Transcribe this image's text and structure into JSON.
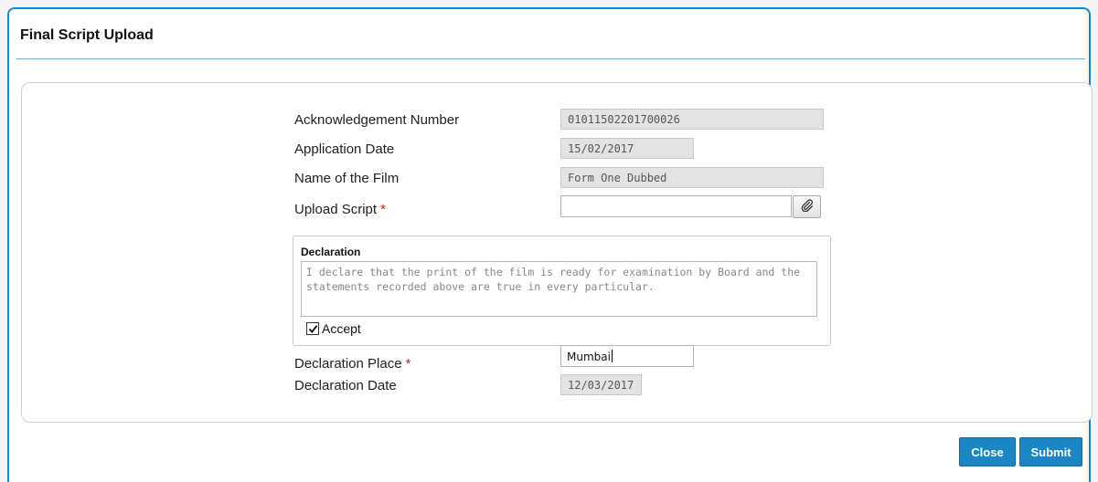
{
  "dialog": {
    "title": "Final Script Upload"
  },
  "form": {
    "ack_label": "Acknowledgement Number",
    "ack_value": "01011502201700026",
    "app_date_label": "Application Date",
    "app_date_value": "15/02/2017",
    "film_label": "Name of the Film",
    "film_value": "Form One Dubbed",
    "upload_label": "Upload Script",
    "upload_value": "",
    "required_marker": "*",
    "attach_icon": "paperclip-icon",
    "declaration": {
      "title": "Declaration",
      "text": "I declare that the print of the film is ready for examination by Board and the statements recorded above are true in every particular.",
      "accept_label": "Accept",
      "accept_checked": true
    },
    "place_label": "Declaration Place",
    "place_value": "Mumbai",
    "decl_date_label": "Declaration Date",
    "decl_date_value": "12/03/2017"
  },
  "buttons": {
    "close": "Close",
    "submit": "Submit"
  },
  "colors": {
    "accent": "#1a87c4",
    "required": "#d21f1f"
  }
}
